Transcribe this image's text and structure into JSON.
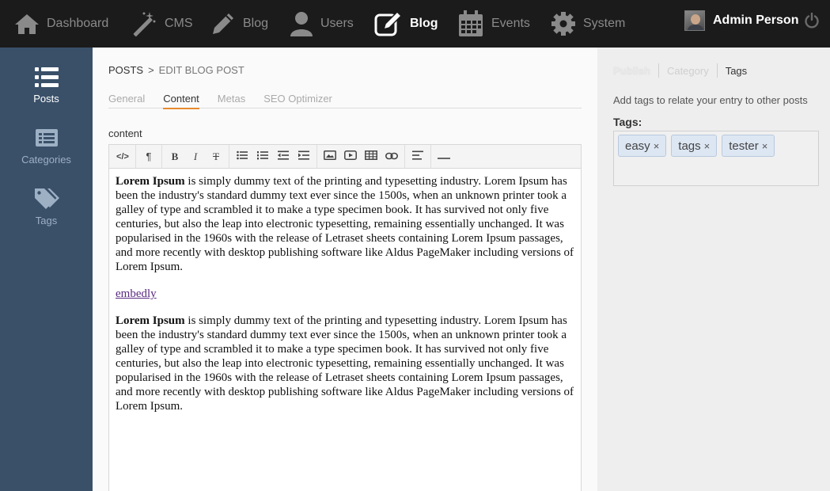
{
  "topnav": {
    "items": [
      {
        "label": "Dashboard",
        "icon": "home-icon"
      },
      {
        "label": "CMS",
        "icon": "magic-wand-icon"
      },
      {
        "label": "Blog",
        "icon": "pencil-icon"
      },
      {
        "label": "Users",
        "icon": "user-icon"
      },
      {
        "label": "Blog",
        "icon": "edit-icon",
        "active": true
      },
      {
        "label": "Events",
        "icon": "calendar-icon"
      },
      {
        "label": "System",
        "icon": "gear-icon"
      }
    ],
    "user_name": "Admin Person"
  },
  "sidebar": {
    "items": [
      {
        "label": "Posts",
        "icon": "list-icon",
        "active": true
      },
      {
        "label": "Categories",
        "icon": "categories-icon"
      },
      {
        "label": "Tags",
        "icon": "tags-icon"
      }
    ]
  },
  "breadcrumb": {
    "parent": "POSTS",
    "separator": ">",
    "current": "EDIT BLOG POST"
  },
  "tabs": [
    {
      "label": "General"
    },
    {
      "label": "Content",
      "active": true
    },
    {
      "label": "Metas"
    },
    {
      "label": "SEO Optimizer"
    }
  ],
  "editor": {
    "field_label": "content",
    "toolbar": {
      "html": "</>",
      "paragraph": "¶",
      "bold": "B",
      "italic": "I",
      "strike": "T"
    },
    "paragraph1_bold": "Lorem Ipsum",
    "paragraph1_rest": " is simply dummy text of the printing and typesetting industry. Lorem Ipsum has been the industry's standard dummy text ever since the 1500s, when an unknown printer took a galley of type and scrambled it to make a type specimen book. It has survived not only five centuries, but also the leap into electronic typesetting, remaining essentially unchanged. It was popularised in the 1960s with the release of Letraset sheets containing Lorem Ipsum passages, and more recently with desktop publishing software like Aldus PageMaker including versions of Lorem Ipsum.",
    "link_text": "embedly",
    "paragraph2_bold": "Lorem Ipsum",
    "paragraph2_rest": " is simply dummy text of the printing and typesetting industry. Lorem Ipsum has been the industry's standard dummy text ever since the 1500s, when an unknown printer took a galley of type and scrambled it to make a type specimen book. It has survived not only five centuries, but also the leap into electronic typesetting, remaining essentially unchanged. It was popularised in the 1960s with the release of Letraset sheets containing Lorem Ipsum passages, and more recently with desktop publishing software like Aldus PageMaker including versions of Lorem Ipsum."
  },
  "rpanel": {
    "tabs": [
      {
        "label": "Publish"
      },
      {
        "label": "Category"
      },
      {
        "label": "Tags",
        "active": true
      }
    ],
    "description": "Add tags to relate your entry to other posts",
    "tags_label": "Tags:",
    "tags": [
      "easy",
      "tags",
      "tester"
    ],
    "remove_symbol": "×"
  },
  "colors": {
    "topnav_bg": "#1b1b1b",
    "sidebar_bg": "#3a5069",
    "tab_accent": "#e68a2e",
    "tag_bg": "#dde7f3"
  }
}
